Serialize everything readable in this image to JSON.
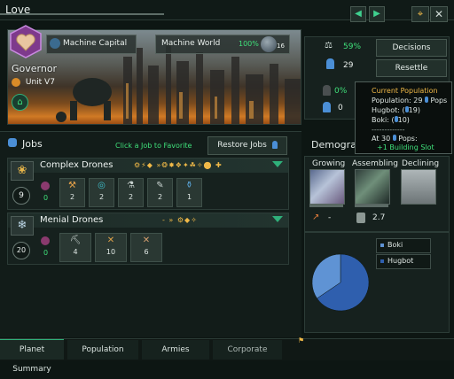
{
  "window": {
    "title": "Love"
  },
  "header": {
    "capital_label": "Machine Capital",
    "world_label": "Machine World",
    "habitability": "100%",
    "planet_size": "16",
    "governor_label": "Governor",
    "unit_label": "Unit V7"
  },
  "stats": {
    "stability": "59%",
    "pops": "29",
    "crime": "0%",
    "amenities": "0",
    "decisions_label": "Decisions",
    "resettle_label": "Resettle"
  },
  "tooltip": {
    "title": "Current Population",
    "line1": "Population: 29",
    "line1_suffix": "Pops",
    "line2": "Hugbot: (",
    "line2_value": "19)",
    "line3": "Boki: (",
    "line3_value": "10)",
    "divider": "-------------",
    "line4": "At 30",
    "line4_suffix": "Pops:",
    "line5": "+1 Building Slot"
  },
  "jobs": {
    "title": "Jobs",
    "hint": "Click a Job to Favorite",
    "restore_label": "Restore Jobs",
    "groups": [
      {
        "name": "Complex Drones",
        "count": "9",
        "unemployed": "0",
        "slots": [
          "2",
          "2",
          "2",
          "2",
          "1"
        ]
      },
      {
        "name": "Menial Drones",
        "count": "20",
        "unemployed": "0",
        "slots": [
          "4",
          "10",
          "6"
        ]
      }
    ]
  },
  "demographics": {
    "title": "Demographics",
    "columns": [
      "Growing",
      "Assembling",
      "Declining"
    ],
    "assembling_value": "2.7",
    "growing_value": "-",
    "legend": [
      "Boki",
      "Hugbot"
    ],
    "shares": [
      {
        "name": "Hugbot",
        "value": 19,
        "color": "#2f5fae"
      },
      {
        "name": "Boki",
        "value": 10,
        "color": "#5f93d4"
      }
    ]
  },
  "bottom_tabs": [
    "Planet Summary",
    "Population",
    "Armies",
    "Corporate"
  ],
  "colors": {
    "accent": "#2fb07a",
    "gold": "#f0b948",
    "blue": "#2f5fae"
  }
}
